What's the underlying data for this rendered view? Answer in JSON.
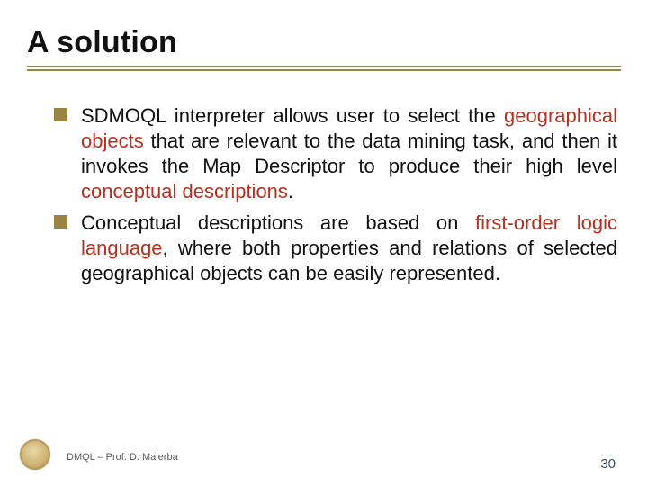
{
  "title": "A solution",
  "bullets": [
    {
      "runs": [
        {
          "text": "SDMOQL interpreter allows user to select the ",
          "style": "normal"
        },
        {
          "text": "geographical objects",
          "style": "red"
        },
        {
          "text": " that are relevant to the data mining task, and then it invokes the Map Descriptor to produce their high level ",
          "style": "normal"
        },
        {
          "text": "conceptual descriptions",
          "style": "red"
        },
        {
          "text": ".",
          "style": "normal"
        }
      ]
    },
    {
      "runs": [
        {
          "text": "Conceptual descriptions are based on ",
          "style": "normal"
        },
        {
          "text": "first-order logic language",
          "style": "red"
        },
        {
          "text": ", where both properties and relations of selected geographical objects can be easily represented.",
          "style": "normal"
        }
      ]
    }
  ],
  "footer": "DMQL – Prof. D. Malerba",
  "page_number": "30",
  "colors": {
    "accent": "#9a8440",
    "highlight": "#b63020"
  }
}
